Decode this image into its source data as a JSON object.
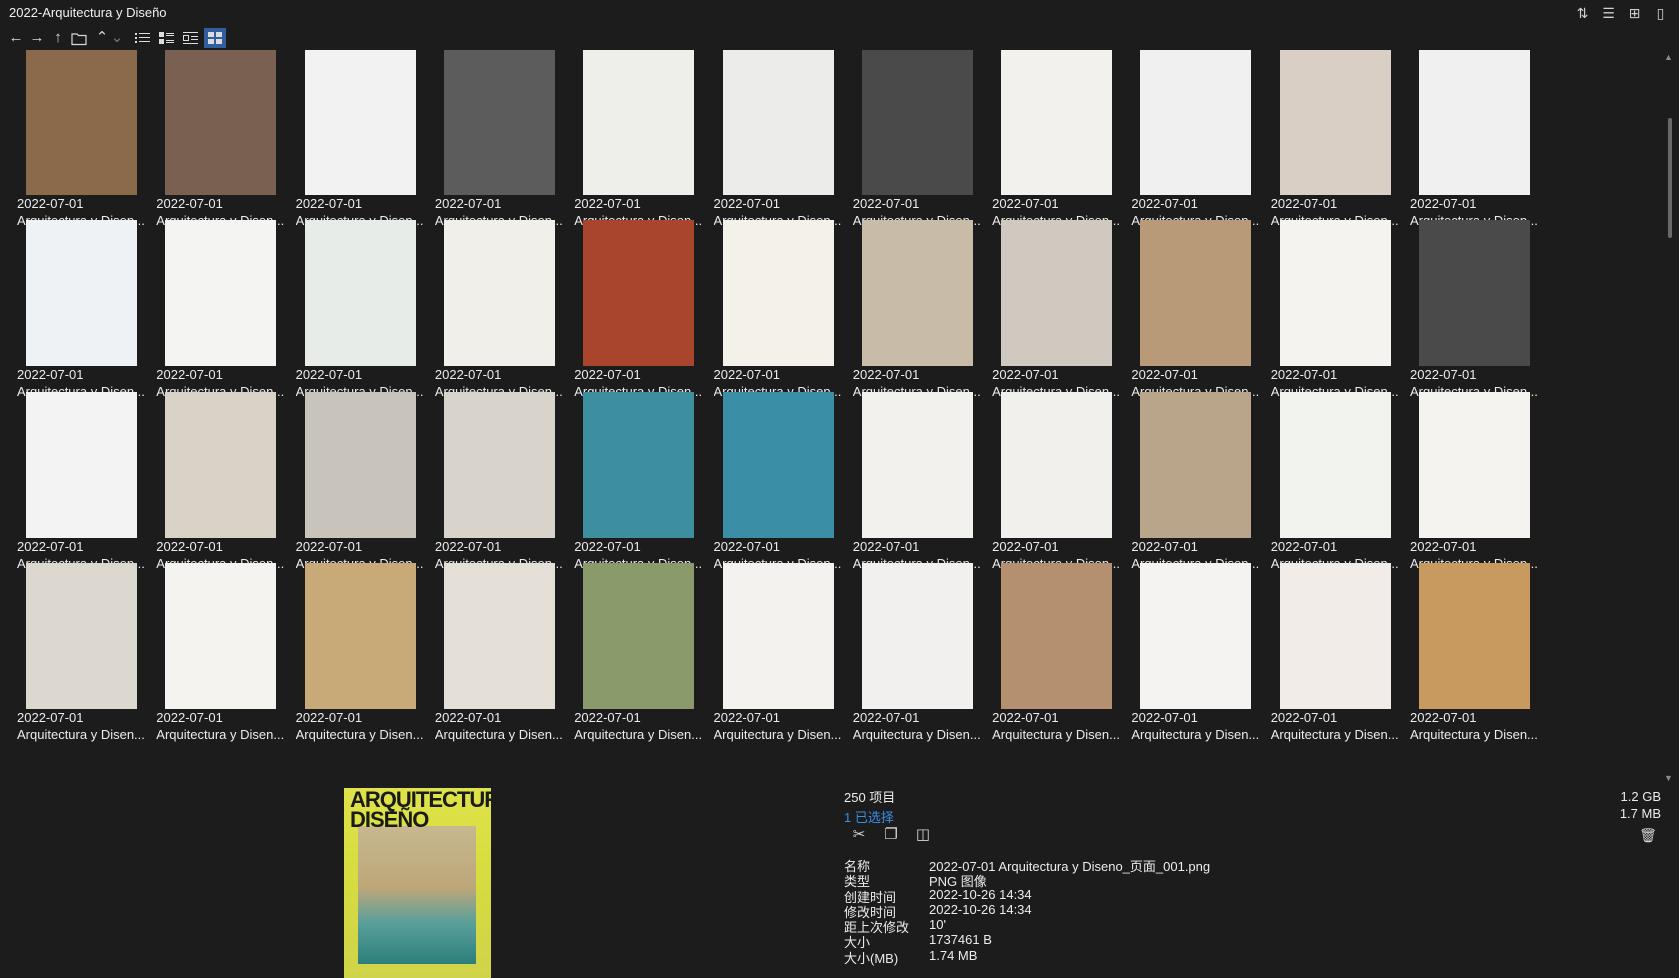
{
  "window": {
    "title": "2022-Arquitectura y Diseño"
  },
  "title_icons": [
    "sort-icon",
    "details-list-icon",
    "new-window-icon",
    "clipboard-icon"
  ],
  "toolbar": {
    "nav_icons": [
      "back-arrow-icon",
      "forward-arrow-icon",
      "up-arrow-icon",
      "folder-icon",
      "chevron-up-icon",
      "chevron-down-icon"
    ],
    "view_modes": [
      "list-view-icon",
      "details-view-icon",
      "tiles-view-icon",
      "thumbnails-view-icon"
    ],
    "active_view": "thumbnails-view-icon"
  },
  "tiles": [
    {
      "date": "2022-07-01",
      "name": "Arquitectura y Disen..."
    },
    {
      "date": "2022-07-01",
      "name": "Arquitectura y Disen..."
    },
    {
      "date": "2022-07-01",
      "name": "Arquitectura y Disen..."
    },
    {
      "date": "2022-07-01",
      "name": "Arquitectura y Disen..."
    },
    {
      "date": "2022-07-01",
      "name": "Arquitectura y Disen..."
    },
    {
      "date": "2022-07-01",
      "name": "Arquitectura y Disen..."
    },
    {
      "date": "2022-07-01",
      "name": "Arquitectura y Disen..."
    },
    {
      "date": "2022-07-01",
      "name": "Arquitectura y Disen..."
    },
    {
      "date": "2022-07-01",
      "name": "Arquitectura y Disen..."
    },
    {
      "date": "2022-07-01",
      "name": "Arquitectura y Disen..."
    },
    {
      "date": "2022-07-01",
      "name": "Arquitectura y Disen..."
    },
    {
      "date": "2022-07-01",
      "name": "Arquitectura y Disen..."
    },
    {
      "date": "2022-07-01",
      "name": "Arquitectura y Disen..."
    },
    {
      "date": "2022-07-01",
      "name": "Arquitectura y Disen..."
    },
    {
      "date": "2022-07-01",
      "name": "Arquitectura y Disen..."
    },
    {
      "date": "2022-07-01",
      "name": "Arquitectura y Disen..."
    },
    {
      "date": "2022-07-01",
      "name": "Arquitectura y Disen..."
    },
    {
      "date": "2022-07-01",
      "name": "Arquitectura y Disen..."
    },
    {
      "date": "2022-07-01",
      "name": "Arquitectura y Disen..."
    },
    {
      "date": "2022-07-01",
      "name": "Arquitectura y Disen..."
    },
    {
      "date": "2022-07-01",
      "name": "Arquitectura y Disen..."
    },
    {
      "date": "2022-07-01",
      "name": "Arquitectura y Disen..."
    },
    {
      "date": "2022-07-01",
      "name": "Arquitectura y Disen..."
    },
    {
      "date": "2022-07-01",
      "name": "Arquitectura y Disen..."
    },
    {
      "date": "2022-07-01",
      "name": "Arquitectura y Disen..."
    },
    {
      "date": "2022-07-01",
      "name": "Arquitectura y Disen..."
    },
    {
      "date": "2022-07-01",
      "name": "Arquitectura y Disen..."
    },
    {
      "date": "2022-07-01",
      "name": "Arquitectura y Disen..."
    },
    {
      "date": "2022-07-01",
      "name": "Arquitectura y Disen..."
    },
    {
      "date": "2022-07-01",
      "name": "Arquitectura y Disen..."
    },
    {
      "date": "2022-07-01",
      "name": "Arquitectura y Disen..."
    },
    {
      "date": "2022-07-01",
      "name": "Arquitectura y Disen..."
    },
    {
      "date": "2022-07-01",
      "name": "Arquitectura y Disen..."
    },
    {
      "date": "2022-07-01",
      "name": "Arquitectura y Disen..."
    },
    {
      "date": "2022-07-01",
      "name": "Arquitectura y Disen..."
    },
    {
      "date": "2022-07-01",
      "name": "Arquitectura y Disen..."
    },
    {
      "date": "2022-07-01",
      "name": "Arquitectura y Disen..."
    },
    {
      "date": "2022-07-01",
      "name": "Arquitectura y Disen..."
    },
    {
      "date": "2022-07-01",
      "name": "Arquitectura y Disen..."
    },
    {
      "date": "2022-07-01",
      "name": "Arquitectura y Disen..."
    },
    {
      "date": "2022-07-01",
      "name": "Arquitectura y Disen..."
    },
    {
      "date": "2022-07-01",
      "name": "Arquitectura y Disen..."
    },
    {
      "date": "2022-07-01",
      "name": "Arquitectura y Disen..."
    },
    {
      "date": "2022-07-01",
      "name": "Arquitectura y Disen..."
    }
  ],
  "thumb_colors": [
    "#8a6a4a",
    "#7a6050",
    "#f2f2f2",
    "#5c5c5c",
    "#eeeeea",
    "#ececea",
    "#4a4a4a",
    "#f3f1ee",
    "#f0f0f0",
    "#d9cfc4",
    "#f0f0f0",
    "#eef2f5",
    "#f4f4f2",
    "#e8ece8",
    "#f1efe9",
    "#a8452c",
    "#f4f1ea",
    "#c8bba8",
    "#cfc9c0",
    "#b89a78",
    "#f5f3f0",
    "#4a4a4a",
    "#f3f3f3",
    "#d9d2c6",
    "#c8c4bb",
    "#d8d4cc",
    "#3d8fa0",
    "#3a8ea6",
    "#f3f1ee",
    "#f2f0ec",
    "#b9a58a",
    "#f2f2ef",
    "#f4f3f0",
    "#dcd8cf",
    "#f4f3f0",
    "#c8a978",
    "#e4e0d8",
    "#8a9a6a",
    "#f3f2ef",
    "#f2f0ee",
    "#b59070",
    "#f4f3f1",
    "#f2ece8",
    "#c89a60"
  ],
  "preview": {
    "mag_title_1": "ARQUITECTURA",
    "mag_title_2": "DISEÑO",
    "count": "250 项目",
    "selected": "1 已选择",
    "total_size": "1.2 GB",
    "selected_size": "1.7 MB",
    "action_icons": [
      "cut-icon",
      "copy-icon",
      "compare-icon"
    ],
    "properties": [
      {
        "key": "名称",
        "value": "2022-07-01 Arquitectura y Diseno_页面_001.png"
      },
      {
        "key": "类型",
        "value": "PNG 图像"
      },
      {
        "key": "创建时间",
        "value": "2022-10-26  14:34"
      },
      {
        "key": "修改时间",
        "value": "2022-10-26  14:34"
      },
      {
        "key": "距上次修改",
        "value": "10'"
      },
      {
        "key": "大小",
        "value": "1737461 B"
      },
      {
        "key": "大小(MB)",
        "value": "1.74 MB"
      }
    ]
  }
}
